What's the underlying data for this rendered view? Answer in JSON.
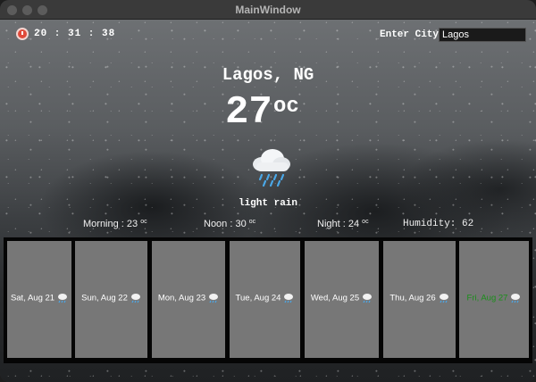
{
  "window": {
    "title": "MainWindow"
  },
  "clock": {
    "time": "20 : 31 : 38"
  },
  "search": {
    "label": "Enter City",
    "value": "Lagos"
  },
  "current": {
    "location": "Lagos, NG",
    "temperature": "27",
    "unit": "oc",
    "condition": "light rain",
    "icon": "rain-cloud-icon"
  },
  "stats": {
    "morning_label": "Morning : ",
    "morning_value": "23",
    "noon_label": "Noon : ",
    "noon_value": "30",
    "night_label": "Night : ",
    "night_value": "24",
    "unit": "oc",
    "humidity": "Humidity: 62"
  },
  "forecast": [
    {
      "label": "Sat, Aug 21",
      "icon": "rain-cloud-icon"
    },
    {
      "label": "Sun, Aug 22",
      "icon": "rain-cloud-icon"
    },
    {
      "label": "Mon, Aug 23",
      "icon": "rain-cloud-icon"
    },
    {
      "label": "Tue, Aug 24",
      "icon": "rain-cloud-icon"
    },
    {
      "label": "Wed, Aug 25",
      "icon": "rain-cloud-icon"
    },
    {
      "label": "Thu, Aug 26",
      "icon": "rain-cloud-icon"
    },
    {
      "label": "Fri, Aug 27",
      "icon": "rain-cloud-icon",
      "today": true
    }
  ],
  "colors": {
    "today_label": "#1a8f1a",
    "card_bg": "#777777"
  }
}
